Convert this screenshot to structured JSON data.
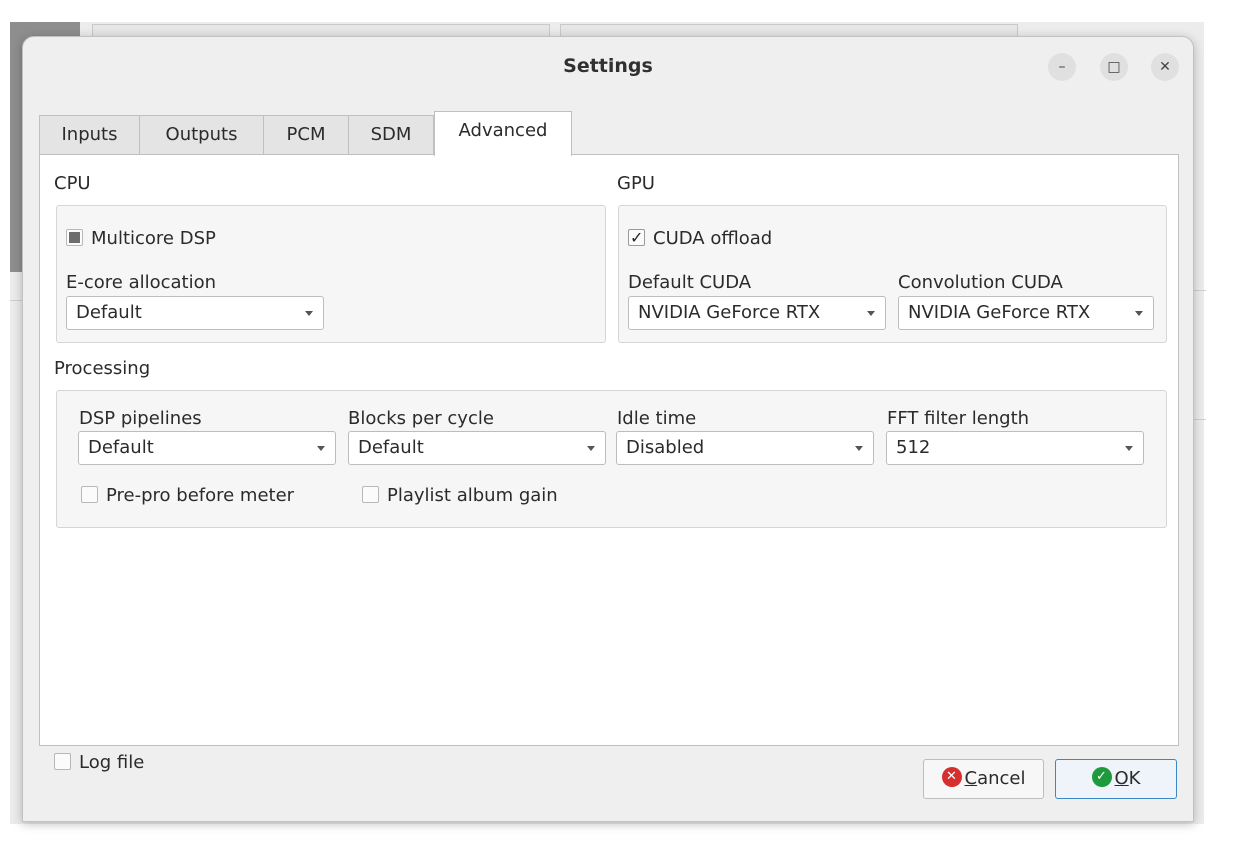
{
  "dialog": {
    "title": "Settings",
    "window_buttons": {
      "minimize": "–",
      "maximize": "□",
      "close": "✕"
    }
  },
  "tabs": [
    {
      "label": "Inputs",
      "active": false
    },
    {
      "label": "Outputs",
      "active": false
    },
    {
      "label": "PCM",
      "active": false
    },
    {
      "label": "SDM",
      "active": false
    },
    {
      "label": "Advanced",
      "active": true
    }
  ],
  "cpu": {
    "heading": "CPU",
    "multicore": {
      "label": "Multicore DSP",
      "state": "partial"
    },
    "ecore": {
      "label": "E-core allocation",
      "value": "Default"
    }
  },
  "gpu": {
    "heading": "GPU",
    "cuda_offload": {
      "label": "CUDA offload",
      "state": "checked"
    },
    "default_cuda": {
      "label": "Default CUDA",
      "value": "NVIDIA GeForce RTX"
    },
    "convolution_cuda": {
      "label": "Convolution CUDA",
      "value": "NVIDIA GeForce RTX"
    }
  },
  "processing": {
    "heading": "Processing",
    "dsp_pipelines": {
      "label": "DSP pipelines",
      "value": "Default"
    },
    "blocks_per_cycle": {
      "label": "Blocks per cycle",
      "value": "Default"
    },
    "idle_time": {
      "label": "Idle time",
      "value": "Disabled"
    },
    "fft_filter_length": {
      "label": "FFT filter length",
      "value": "512"
    },
    "prepro_before_meter": {
      "label": "Pre-pro before meter",
      "state": "unchecked"
    },
    "playlist_album_gain": {
      "label": "Playlist album gain",
      "state": "unchecked"
    }
  },
  "log_file": {
    "label": "Log file",
    "state": "unchecked"
  },
  "buttons": {
    "cancel": {
      "mnemonic": "C",
      "rest": "ancel",
      "icon": "cancel-icon"
    },
    "ok": {
      "mnemonic": "O",
      "rest": "K",
      "icon": "ok-check-icon"
    }
  },
  "colors": {
    "ok_border": "#3a87c9",
    "cancel_icon": "#d62f2f",
    "ok_icon": "#1e9a3c"
  }
}
